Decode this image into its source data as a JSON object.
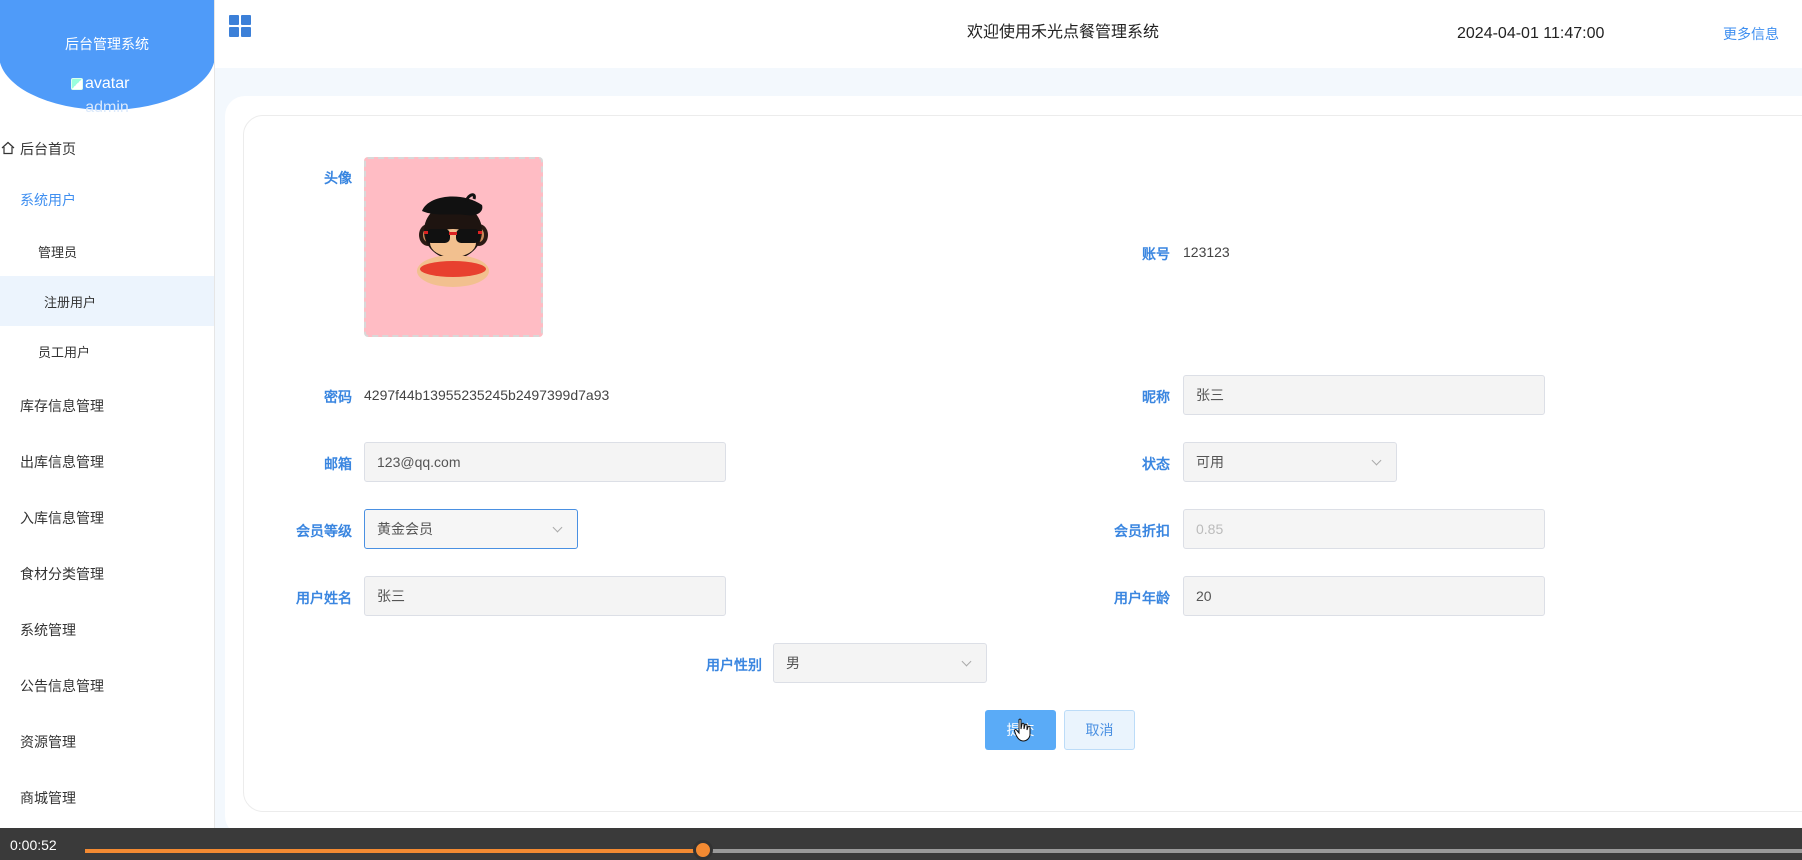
{
  "sidebar": {
    "brand_title": "后台管理系统",
    "avatar_alt": "avatar",
    "username": "admin",
    "items": [
      {
        "label": "后台首页",
        "icon": "home-icon"
      },
      {
        "label": "系统用户"
      },
      {
        "label": "管理员"
      },
      {
        "label": "注册用户"
      },
      {
        "label": "员工用户"
      },
      {
        "label": "库存信息管理"
      },
      {
        "label": "出库信息管理"
      },
      {
        "label": "入库信息管理"
      },
      {
        "label": "食材分类管理"
      },
      {
        "label": "系统管理"
      },
      {
        "label": "公告信息管理"
      },
      {
        "label": "资源管理"
      },
      {
        "label": "商城管理"
      }
    ]
  },
  "header": {
    "title": "欢迎使用禾光点餐管理系统",
    "datetime": "2024-04-01 11:47:00",
    "more": "更多信息"
  },
  "form": {
    "avatar_label": "头像",
    "account_label": "账号",
    "account_value": "123123",
    "password_label": "密码",
    "password_value": "4297f44b13955235245b2497399d7a93",
    "nickname_label": "昵称",
    "nickname_value": "张三",
    "email_label": "邮箱",
    "email_value": "123@qq.com",
    "status_label": "状态",
    "status_value": "可用",
    "member_level_label": "会员等级",
    "member_level_value": "黄金会员",
    "discount_label": "会员折扣",
    "discount_value": "0.85",
    "realname_label": "用户姓名",
    "realname_value": "张三",
    "age_label": "用户年龄",
    "age_value": "20",
    "gender_label": "用户性别",
    "gender_value": "男",
    "submit_label": "提交",
    "cancel_label": "取消"
  },
  "video": {
    "time": "0:00:52",
    "progress": 0.36
  },
  "colors": {
    "accent": "#4f9bf9",
    "progress": "#f38a32",
    "avatar_bg": "#ffbcc4"
  }
}
